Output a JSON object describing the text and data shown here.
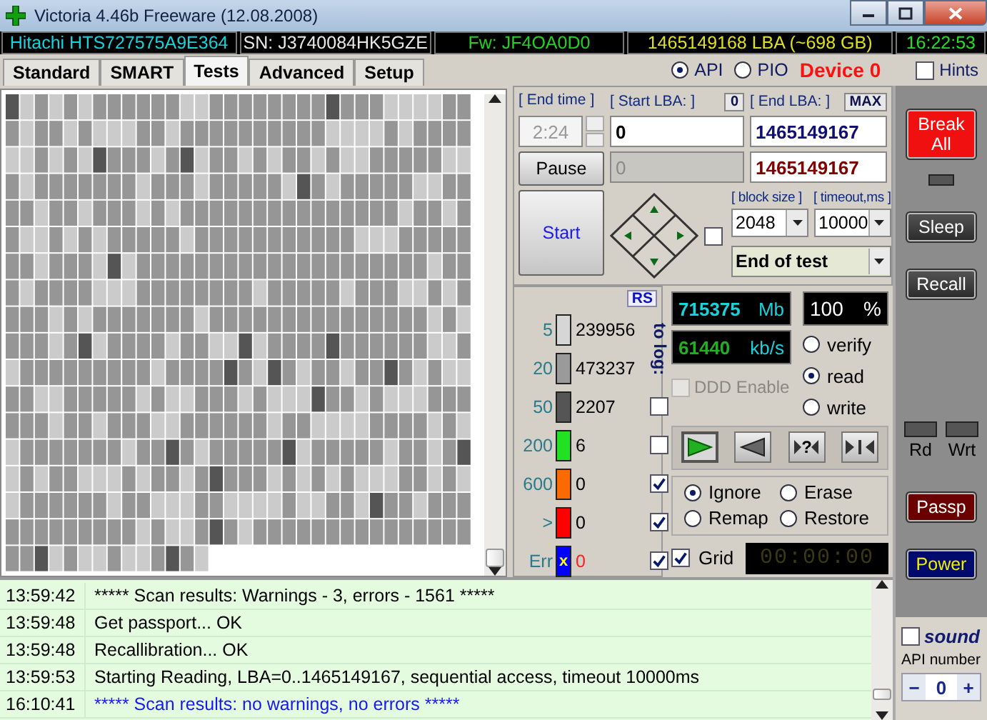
{
  "window": {
    "title": "Victoria 4.46b Freeware (12.08.2008)"
  },
  "info_bar": [
    {
      "text": "Hitachi HTS727575A9E364",
      "kind": "model"
    },
    {
      "text": "SN: J3740084HK5GZE",
      "kind": "serial"
    },
    {
      "text": "Fw: JF4OA0D0",
      "kind": "firmware"
    },
    {
      "text": "1465149168 LBA (~698 GB)",
      "kind": "capacity"
    },
    {
      "text": "16:22:53",
      "kind": "clock"
    }
  ],
  "tabs": [
    {
      "label": "Standard",
      "selected": false
    },
    {
      "label": "SMART",
      "selected": false
    },
    {
      "label": "Tests",
      "selected": true
    },
    {
      "label": "Advanced",
      "selected": false
    },
    {
      "label": "Setup",
      "selected": false
    }
  ],
  "mode_options": [
    {
      "label": "API",
      "selected": true
    },
    {
      "label": "PIO",
      "selected": false
    }
  ],
  "device": "Device 0",
  "hints": {
    "label": "Hints",
    "checked": false
  },
  "test_settings": {
    "end_time": {
      "label": "[ End time ]",
      "value": "2:24",
      "disabled": true
    },
    "start_lba": {
      "label": "[ Start LBA: ]",
      "button": "0",
      "value": "0",
      "current": "0",
      "current_disabled": true
    },
    "end_lba": {
      "label": "[ End LBA: ]",
      "button": "MAX",
      "value": "1465149167",
      "current": "1465149167"
    },
    "pause": "Pause",
    "start": "Start",
    "aux_checked": false,
    "block_size": {
      "label": "[ block size ]",
      "value": "2048"
    },
    "timeout": {
      "label": "[ timeout,ms ]",
      "value": "10000"
    },
    "end_action": "End of test"
  },
  "legend": {
    "reset": "RS",
    "to_log_label": "to log:",
    "rows": [
      {
        "threshold": "5",
        "color": "#d6d6d6",
        "count": "239956"
      },
      {
        "threshold": "20",
        "color": "#9a9a9a",
        "count": "473237"
      },
      {
        "threshold": "50",
        "color": "#555555",
        "count": "2207",
        "to_log": false
      },
      {
        "threshold": "200",
        "color": "#22e022",
        "count": "6",
        "to_log": false
      },
      {
        "threshold": "600",
        "color": "#ff6a00",
        "count": "0",
        "to_log": true
      },
      {
        "threshold": ">",
        "color": "#ff0000",
        "count": "0",
        "to_log": true
      },
      {
        "threshold": "Err",
        "color": "#0000ff",
        "mark": "x",
        "count": "0",
        "kind": "error",
        "to_log": true
      }
    ]
  },
  "stats": {
    "size": "715375",
    "size_unit": "Mb",
    "percent": "100",
    "percent_unit": "%",
    "speed": "61440",
    "speed_unit": "kb/s"
  },
  "read_modes": [
    {
      "label": "verify",
      "selected": false
    },
    {
      "label": "read",
      "selected": true
    },
    {
      "label": "write",
      "selected": false
    }
  ],
  "ddd": {
    "label": "DDD Enable",
    "checked": false,
    "disabled": true
  },
  "direction_buttons": [
    {
      "kind": "forward",
      "selected": true
    },
    {
      "kind": "backward",
      "selected": false
    },
    {
      "kind": "random",
      "label": "?",
      "selected": false
    },
    {
      "kind": "butterfly",
      "selected": false
    }
  ],
  "error_actions": [
    {
      "label": "Ignore",
      "selected": true
    },
    {
      "label": "Erase",
      "selected": false
    },
    {
      "label": "Remap",
      "selected": false
    },
    {
      "label": "Restore",
      "selected": false
    }
  ],
  "grid": {
    "label": "Grid",
    "checked": true
  },
  "timer": "00:00:00",
  "side_buttons": [
    {
      "label": "Break All",
      "kind": "break"
    },
    {
      "label": "Sleep",
      "kind": "plain"
    },
    {
      "label": "Recall",
      "kind": "plain"
    },
    {
      "label": "Passp",
      "kind": "passport"
    },
    {
      "label": "Power",
      "kind": "power"
    }
  ],
  "indicators": [
    {
      "label": "Rd",
      "on": false
    },
    {
      "label": "Wrt",
      "on": false
    }
  ],
  "sound": {
    "label": "sound",
    "checked": false
  },
  "api_number": {
    "label": "API number",
    "value": "0",
    "minus": "−",
    "plus": "+"
  },
  "log": [
    {
      "time": "13:59:42",
      "message": "***** Scan results: Warnings - 3, errors - 1561 *****",
      "kind": "normal"
    },
    {
      "time": "13:59:48",
      "message": "Get passport... OK",
      "kind": "normal"
    },
    {
      "time": "13:59:48",
      "message": "Recallibration... OK",
      "kind": "normal"
    },
    {
      "time": "13:59:53",
      "message": "Starting Reading, LBA=0..1465149167, sequential access, timeout 10000ms",
      "kind": "normal"
    },
    {
      "time": "16:10:41",
      "message": "***** Scan results: no warnings, no errors *****",
      "kind": "highlight"
    }
  ]
}
